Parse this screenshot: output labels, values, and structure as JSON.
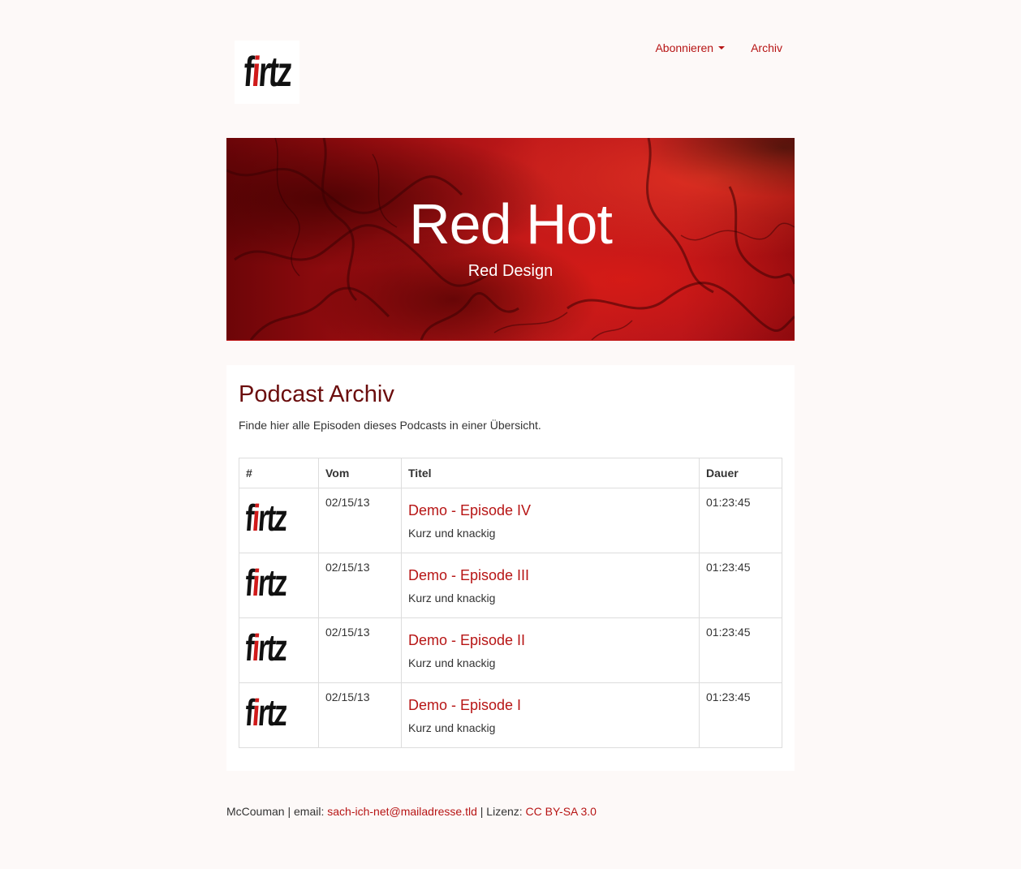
{
  "brand": {
    "logo_prefix": "f",
    "logo_accent": "i",
    "logo_suffix": "rtz",
    "accent_color": "#b71515"
  },
  "nav": {
    "subscribe_label": "Abonnieren",
    "archive_label": "Archiv"
  },
  "hero": {
    "title": "Red Hot",
    "subtitle": "Red Design"
  },
  "main": {
    "title": "Podcast Archiv",
    "lead": "Finde hier alle Episoden dieses Podcasts in einer Übersicht."
  },
  "table": {
    "headers": [
      "#",
      "Vom",
      "Titel",
      "Dauer"
    ],
    "rows": [
      {
        "date": "02/15/13",
        "title": "Demo - Episode IV",
        "subtitle": "Kurz und knackig",
        "duration": "01:23:45"
      },
      {
        "date": "02/15/13",
        "title": "Demo - Episode III",
        "subtitle": "Kurz und knackig",
        "duration": "01:23:45"
      },
      {
        "date": "02/15/13",
        "title": "Demo - Episode II",
        "subtitle": "Kurz und knackig",
        "duration": "01:23:45"
      },
      {
        "date": "02/15/13",
        "title": "Demo - Episode I",
        "subtitle": "Kurz und knackig",
        "duration": "01:23:45"
      }
    ]
  },
  "footer": {
    "author": "McCouman",
    "email_label": "| email:",
    "email": "sach-ich-net@mailadresse.tld",
    "license_label": "| Lizenz:",
    "license": "CC BY-SA 3.0"
  }
}
